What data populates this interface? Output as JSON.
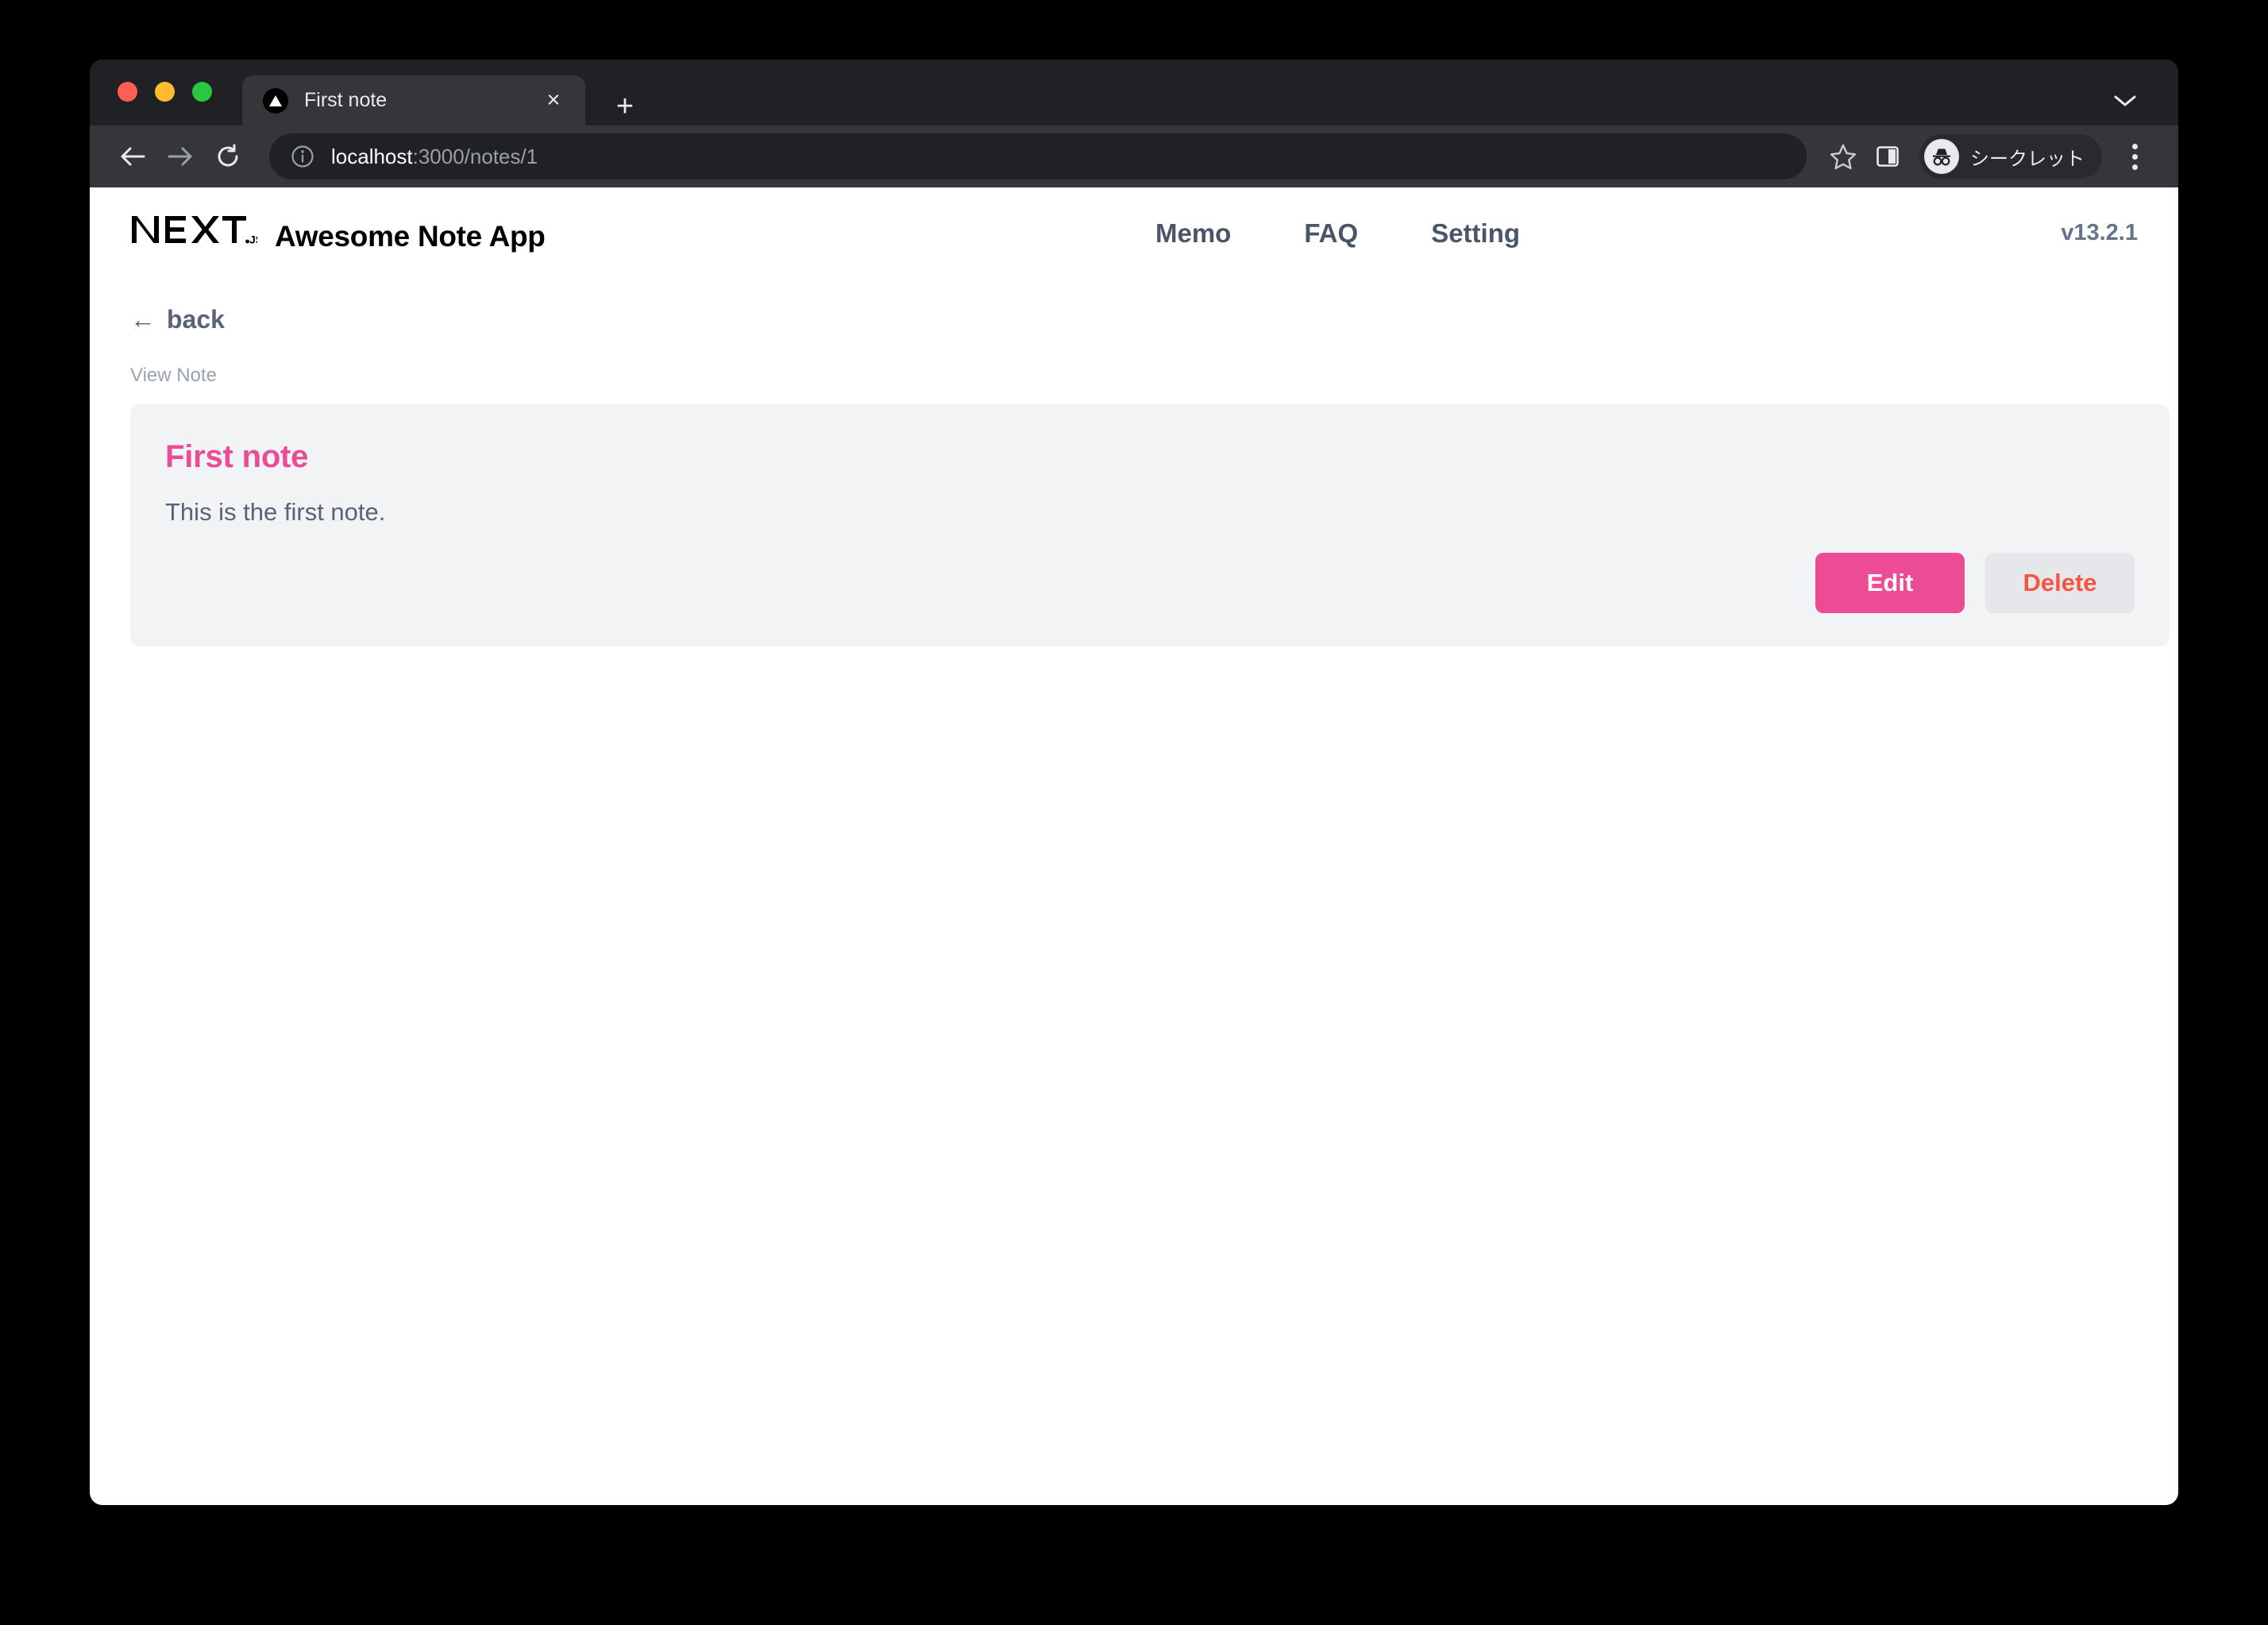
{
  "browser": {
    "traffic_lights": [
      "close",
      "minimize",
      "zoom"
    ],
    "tab": {
      "title": "First note",
      "favicon": "nextjs-triangle-icon",
      "close_label": "×"
    },
    "new_tab_label": "+",
    "tabstrip_chevron": "chevron-down-icon",
    "toolbar": {
      "back": "back-arrow-icon",
      "forward": "forward-arrow-icon",
      "reload": "reload-icon",
      "site_info": "info-circle-icon",
      "url_host": "localhost",
      "url_path": ":3000/notes/1",
      "bookmark": "star-icon",
      "side_panel": "side-panel-icon",
      "incognito_label": "シークレット",
      "menu": "kebab-menu-icon"
    }
  },
  "app": {
    "logo_text": "NEXT",
    "logo_suffix": ".JS",
    "title": "Awesome Note App",
    "nav": [
      {
        "label": "Memo"
      },
      {
        "label": "FAQ"
      },
      {
        "label": "Setting"
      }
    ],
    "version": "v13.2.1"
  },
  "main": {
    "back_label": "back",
    "back_arrow": "←",
    "breadcrumb": "View Note",
    "note": {
      "title": "First note",
      "body": "This is the first note.",
      "edit_label": "Edit",
      "delete_label": "Delete"
    }
  },
  "colors": {
    "accent_pink": "#ec4b96",
    "delete_red": "#f7553f",
    "card_bg": "#f1f3f5",
    "nav_text": "#4a5568",
    "page_bg": "#000000",
    "browser_chrome": "#35363a",
    "tabstrip_bg": "#202124"
  }
}
